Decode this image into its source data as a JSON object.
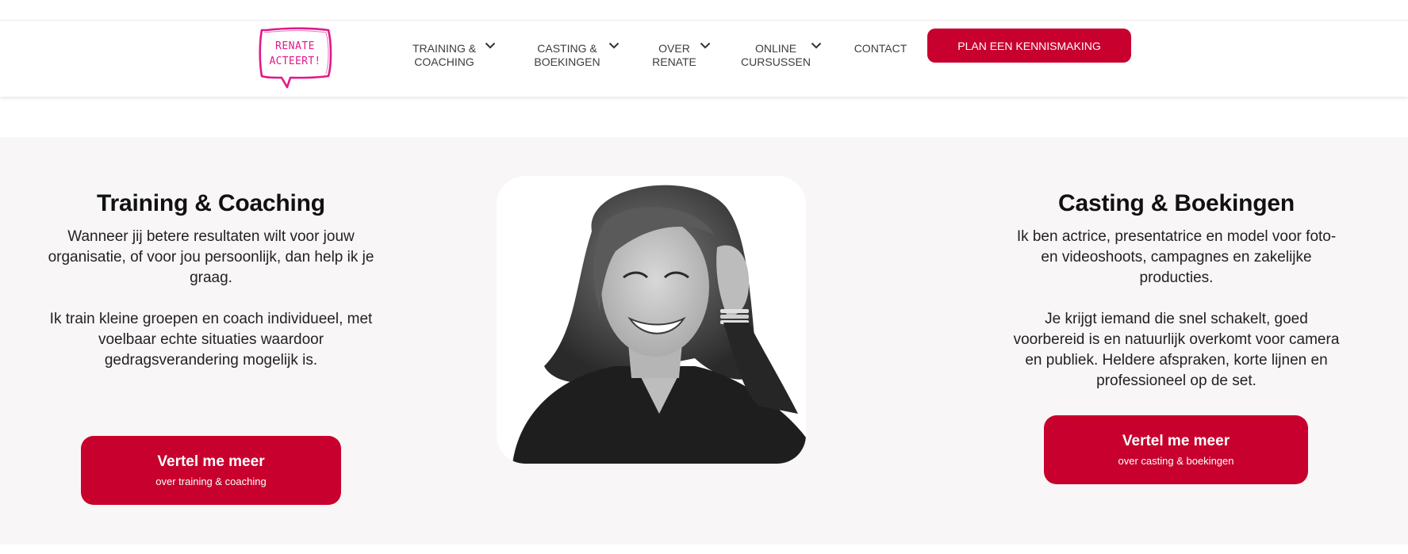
{
  "header": {
    "logo_text_line1": "RENATE",
    "logo_text_line2": "ACTEERT!",
    "nav": [
      {
        "line1": "TRAINING &",
        "line2": "COACHING",
        "has_dropdown": true
      },
      {
        "line1": "CASTING &",
        "line2": "BOEKINGEN",
        "has_dropdown": true
      },
      {
        "line1": "OVER",
        "line2": "RENATE",
        "has_dropdown": true
      },
      {
        "line1": "ONLINE",
        "line2": "CURSUSSEN",
        "has_dropdown": true
      },
      {
        "line1": "CONTACT",
        "line2": "",
        "has_dropdown": false
      }
    ],
    "cta_label": "PLAN EEN KENNISMAKING"
  },
  "training": {
    "title": "Training & Coaching",
    "para1": "Wanneer jij betere resultaten wilt voor jouw organisatie, of voor jou persoonlijk, dan help ik je graag.",
    "para2": "Ik train kleine groepen en coach individueel, met voelbaar echte situaties waardoor gedragsverandering mogelijk is.",
    "button_main": "Vertel me meer",
    "button_sub": "over training & coaching"
  },
  "casting": {
    "title": "Casting & Boekingen",
    "para1": "Ik ben actrice, presentatrice en model voor foto- en videoshoots, campagnes en zakelijke producties.",
    "para2": "Je krijgt iemand die snel schakelt, goed voorbereid is en natuurlijk overkomt voor camera en publiek. Heldere afspraken, korte lijnen en professioneel op de set.",
    "button_main": "Vertel me meer",
    "button_sub": "over casting & boekingen"
  },
  "colors": {
    "brand_red": "#c8002d",
    "logo_pink": "#e0198a",
    "section_bg": "#f8f6f6"
  },
  "icons": {
    "nav_dropdown": "chevron-down-icon",
    "portrait": "portrait-photo"
  }
}
